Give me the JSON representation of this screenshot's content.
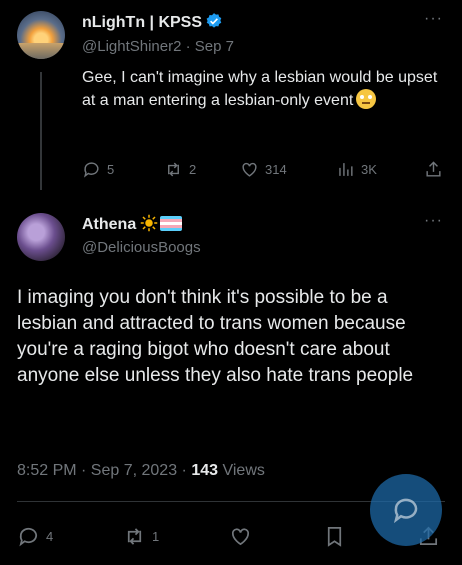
{
  "tweet1": {
    "name": "nLighTn | KPSS",
    "handle": "@LightShiner2",
    "date": "· Sep 7",
    "text": "Gee, I can't imagine why a lesbian would be upset at a man entering a lesbian-only event",
    "emoji": "face-with-rolling-eyes",
    "replies": "5",
    "reposts": "2",
    "likes": "314",
    "views": "3K"
  },
  "tweet2": {
    "name": "Athena",
    "name_emojis": [
      "sun",
      "transgender-flag"
    ],
    "handle": "@DeliciousBoogs",
    "text": "I imaging you don't think it's possible to be a lesbian and attracted to trans women because you're a raging bigot who doesn't care about anyone else unless they also hate trans people",
    "time": "8:52 PM · Sep 7, 2023 ·",
    "view_count": "143",
    "views_label": "Views",
    "replies": "4",
    "reposts": "1"
  },
  "more_label": "···",
  "colors": {
    "background": "#000000",
    "muted": "#71767b",
    "text": "#e7e9ea",
    "verified": "#1d9bf0",
    "fab": "#1d6baa"
  }
}
